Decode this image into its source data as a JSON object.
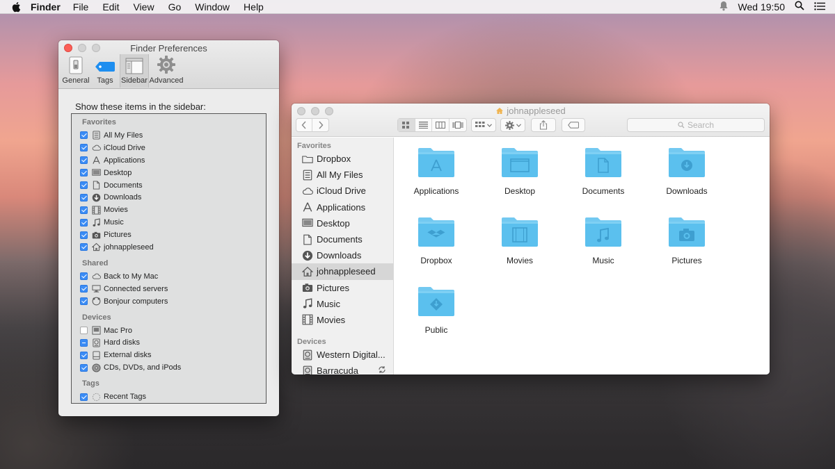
{
  "menubar": {
    "app_name": "Finder",
    "menus": [
      "File",
      "Edit",
      "View",
      "Go",
      "Window",
      "Help"
    ],
    "clock": "Wed 19:50"
  },
  "prefs": {
    "title": "Finder Preferences",
    "tabs": [
      {
        "label": "General",
        "icon": "switch-icon"
      },
      {
        "label": "Tags",
        "icon": "tag-icon"
      },
      {
        "label": "Sidebar",
        "icon": "sidebar-icon",
        "active": true
      },
      {
        "label": "Advanced",
        "icon": "gear-icon"
      }
    ],
    "heading": "Show these items in the sidebar:",
    "sections": {
      "favorites": "Favorites",
      "shared": "Shared",
      "devices": "Devices",
      "tags": "Tags"
    },
    "favorites": [
      {
        "label": "All My Files",
        "state": "on"
      },
      {
        "label": "iCloud Drive",
        "state": "on"
      },
      {
        "label": "Applications",
        "state": "on"
      },
      {
        "label": "Desktop",
        "state": "on"
      },
      {
        "label": "Documents",
        "state": "on"
      },
      {
        "label": "Downloads",
        "state": "on"
      },
      {
        "label": "Movies",
        "state": "on"
      },
      {
        "label": "Music",
        "state": "on"
      },
      {
        "label": "Pictures",
        "state": "on"
      },
      {
        "label": "johnappleseed",
        "state": "on"
      }
    ],
    "shared": [
      {
        "label": "Back to My Mac",
        "state": "on"
      },
      {
        "label": "Connected servers",
        "state": "on"
      },
      {
        "label": "Bonjour computers",
        "state": "on"
      }
    ],
    "devices": [
      {
        "label": "Mac Pro",
        "state": "off"
      },
      {
        "label": "Hard disks",
        "state": "mixed"
      },
      {
        "label": "External disks",
        "state": "on"
      },
      {
        "label": "CDs, DVDs, and iPods",
        "state": "on"
      }
    ],
    "tags": [
      {
        "label": "Recent Tags",
        "state": "on"
      }
    ]
  },
  "finder": {
    "title": "johnappleseed",
    "search_placeholder": "Search",
    "sidebar": {
      "favorites_heading": "Favorites",
      "devices_heading": "Devices",
      "favorites": [
        "Dropbox",
        "All My Files",
        "iCloud Drive",
        "Applications",
        "Desktop",
        "Documents",
        "Downloads",
        "johnappleseed",
        "Pictures",
        "Music",
        "Movies"
      ],
      "selected": "johnappleseed",
      "devices": [
        "Western Digital...",
        "Barracuda"
      ]
    },
    "items": [
      "Applications",
      "Desktop",
      "Documents",
      "Downloads",
      "Dropbox",
      "Movies",
      "Music",
      "Pictures",
      "Public"
    ],
    "folder_color": "#5bc0ee"
  }
}
